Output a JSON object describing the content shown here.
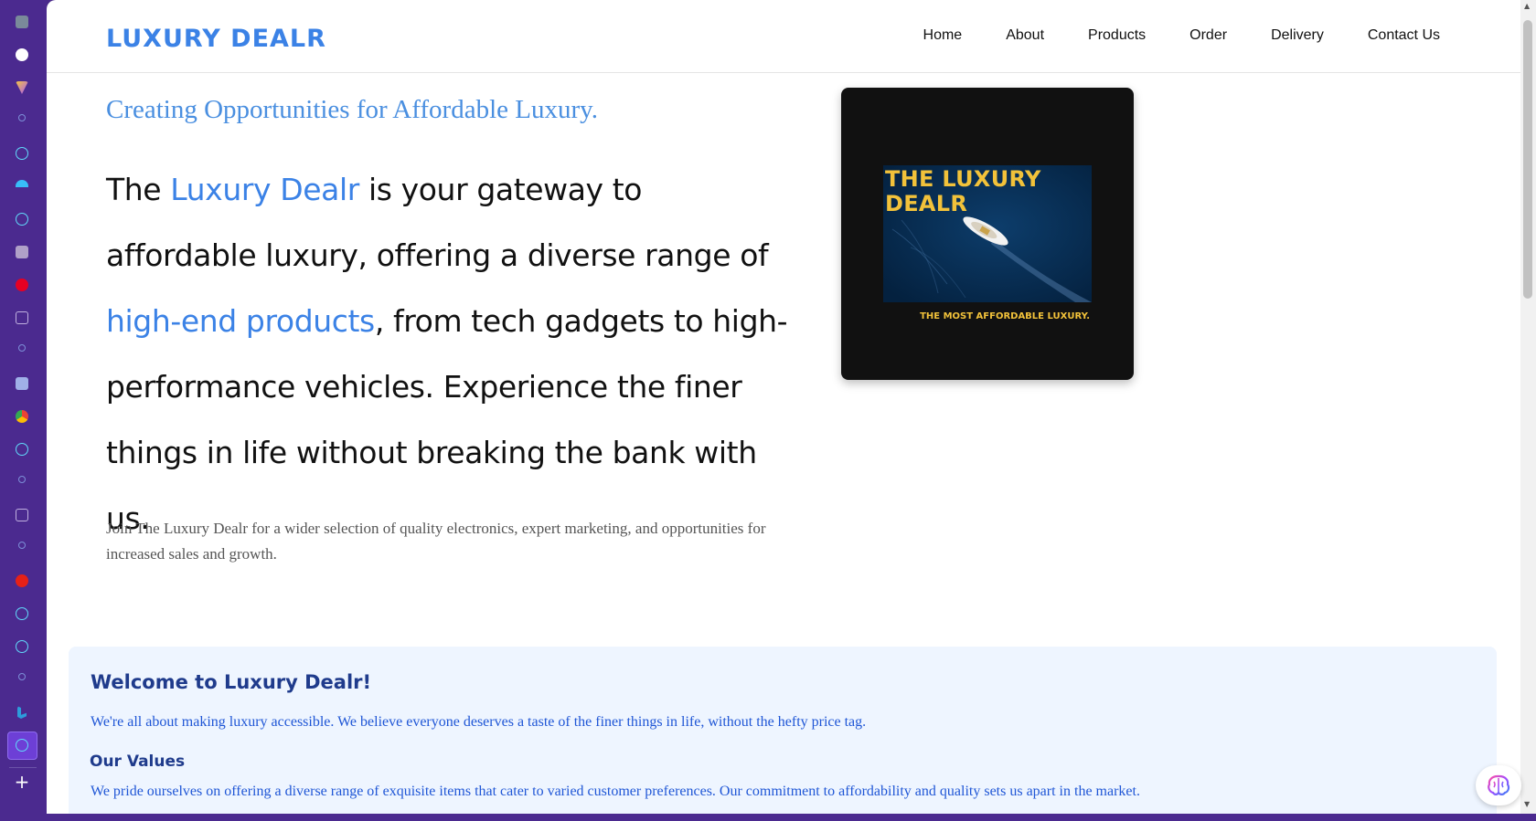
{
  "rail": {
    "icons": [
      "apps-icon",
      "github-icon",
      "vite-icon",
      "search-icon",
      "react-icon",
      "tailwind-icon",
      "react-icon",
      "bookmark-icon",
      "pinterest-icon",
      "calendar-icon",
      "search-icon",
      "layout-icon",
      "chrome-icon",
      "react-icon",
      "search-icon",
      "calendar-icon",
      "search-icon",
      "youtube-icon",
      "react-icon",
      "react-icon",
      "search-icon",
      "bing-icon",
      "react-icon"
    ],
    "add_label": "+"
  },
  "header": {
    "brand": "LUXURY DEALR",
    "nav": [
      "Home",
      "About",
      "Products",
      "Order",
      "Delivery",
      "Contact Us"
    ]
  },
  "hero": {
    "tagline": "Creating Opportunities for Affordable Luxury.",
    "part1": "The ",
    "highlight1": "Luxury Dealr",
    "part2": " is your gateway to affordable luxury, offering a diverse range of ",
    "highlight2": "high-end products",
    "part3": ", from tech gadgets to high-performance vehicles. Experience the finer things in life without breaking the bank with us.",
    "sub": "Join The Luxury Dealr for a wider selection of quality electronics, expert marketing, and opportunities for increased sales and growth."
  },
  "card": {
    "title_line1": "THE  LUXURY",
    "title_line2": "DEALR",
    "caption": "THE MOST AFFORDABLE LUXURY."
  },
  "welcome": {
    "heading": "Welcome to Luxury Dealr!",
    "intro": "We're all about making luxury accessible. We believe everyone deserves a taste of the finer things in life, without the hefty price tag.",
    "values_heading": "Our Values",
    "values_text": "We pride ourselves on offering a diverse range of exquisite items that cater to varied customer preferences. Our commitment to affordability and quality sets us apart in the market."
  },
  "colors": {
    "accent": "#3b82e6",
    "rail": "#4b2a8f",
    "gold": "#f2c23a",
    "panel_bg": "#eef5ff",
    "panel_heading": "#1f3b8c"
  }
}
